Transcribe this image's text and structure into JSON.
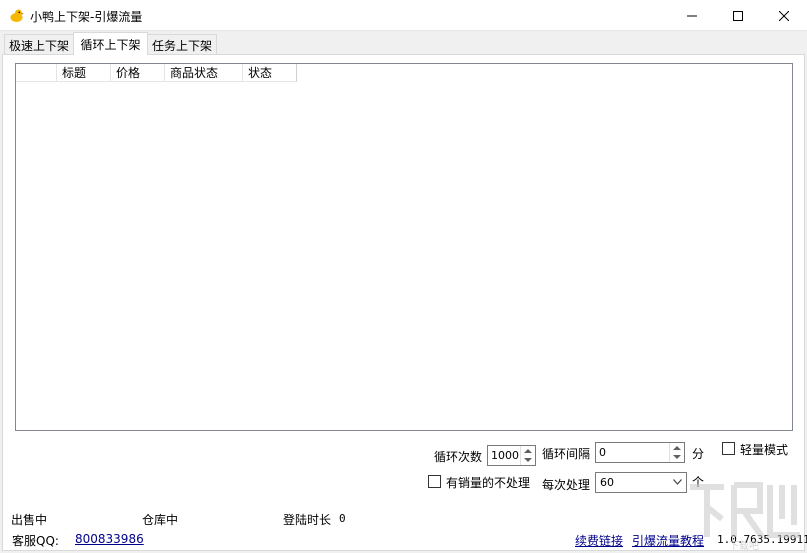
{
  "window": {
    "title": "小鸭上下架-引爆流量",
    "controls": {
      "minimize": "minimize",
      "maximize": "maximize",
      "close": "close"
    }
  },
  "tabs": [
    {
      "label": "极速上下架",
      "active": false
    },
    {
      "label": "循环上下架",
      "active": true
    },
    {
      "label": "任务上下架",
      "active": false
    }
  ],
  "listview": {
    "columns": [
      "",
      "标题",
      "价格",
      "商品状态",
      "状态"
    ],
    "rows": []
  },
  "controls": {
    "loop_count_label": "循环次数",
    "loop_count_value": "1000",
    "loop_interval_label": "循环间隔",
    "loop_interval_value": "0",
    "loop_interval_unit": "分",
    "light_mode_label": "轻量模式",
    "light_mode_checked": false,
    "skip_sold_label": "有销量的不处理",
    "skip_sold_checked": false,
    "per_batch_label": "每次处理",
    "per_batch_value": "60",
    "per_batch_unit": "个"
  },
  "status": {
    "on_sale_label": "出售中",
    "warehouse_label": "仓库中",
    "login_duration_label": "登陆时长",
    "login_duration_value": "0",
    "support_qq_label": "客服QQ:",
    "support_qq_value": "800833986",
    "renew_link": "续费链接",
    "tutorial_link": "引爆流量教程",
    "version": "1.0.7635.19911"
  },
  "watermark": {
    "text": "下载吧"
  },
  "colors": {
    "link": "#00008b",
    "active_tab_bg": "#ffffff",
    "window_bg": "#f0f0f0"
  }
}
